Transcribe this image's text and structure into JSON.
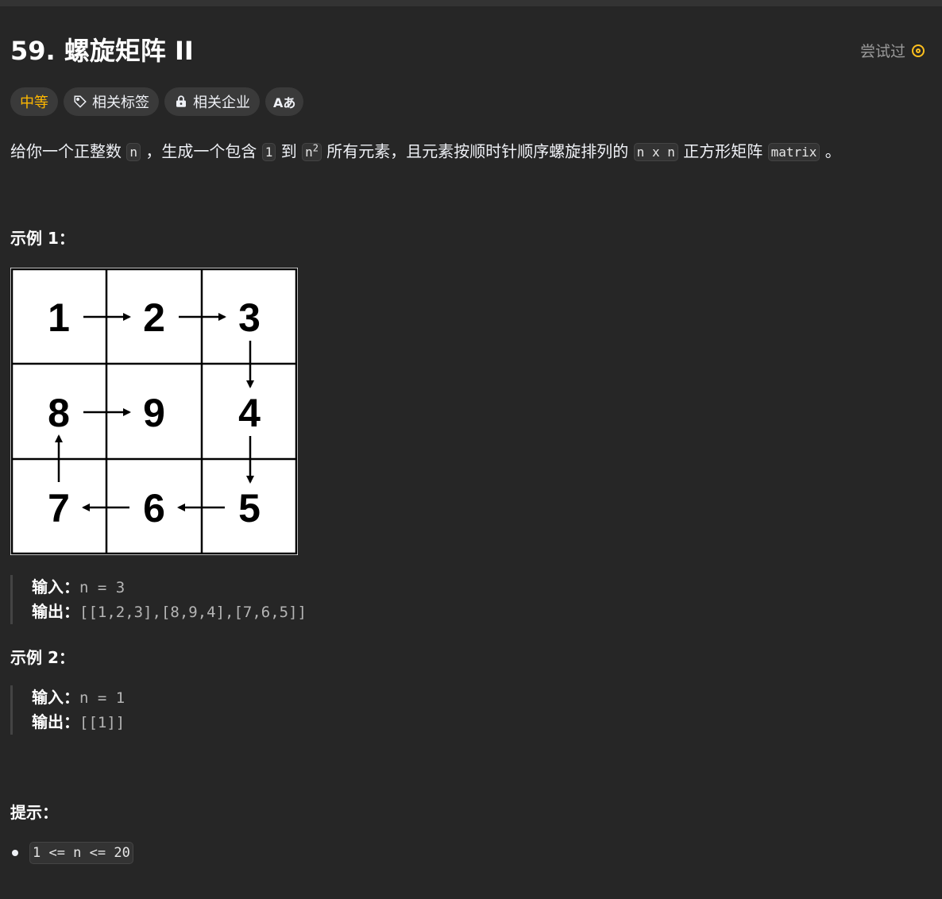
{
  "problem": {
    "title": "59. 螺旋矩阵 II",
    "status": "尝试过",
    "tags": {
      "difficulty": "中等",
      "related_tags": "相关标签",
      "related_companies": "相关企业",
      "translate": "Aあ"
    },
    "description": {
      "p1": "给你一个正整数 ",
      "c1": "n",
      "p2": " ，生成一个包含 ",
      "c2": "1",
      "p3": " 到 ",
      "c3_base": "n",
      "c3_sup": "2",
      "p4": " 所有元素，且元素按顺时针顺序螺旋排列的 ",
      "c4": "n x n",
      "p5": " 正方形矩阵 ",
      "c5": "matrix",
      "p6": " 。"
    },
    "example1": {
      "heading": "示例 1：",
      "grid": [
        "1",
        "2",
        "3",
        "8",
        "9",
        "4",
        "7",
        "6",
        "5"
      ],
      "input_label": "输入：",
      "input_value": "n = 3",
      "output_label": "输出：",
      "output_value": "[[1,2,3],[8,9,4],[7,6,5]]"
    },
    "example2": {
      "heading": "示例 2：",
      "input_label": "输入：",
      "input_value": "n = 1",
      "output_label": "输出：",
      "output_value": "[[1]]"
    },
    "hints": {
      "heading": "提示：",
      "items": [
        "1 <= n <= 20"
      ]
    }
  },
  "colors": {
    "background": "#262626",
    "difficulty": "#ffb800",
    "tried_icon": "#ffc01e"
  }
}
